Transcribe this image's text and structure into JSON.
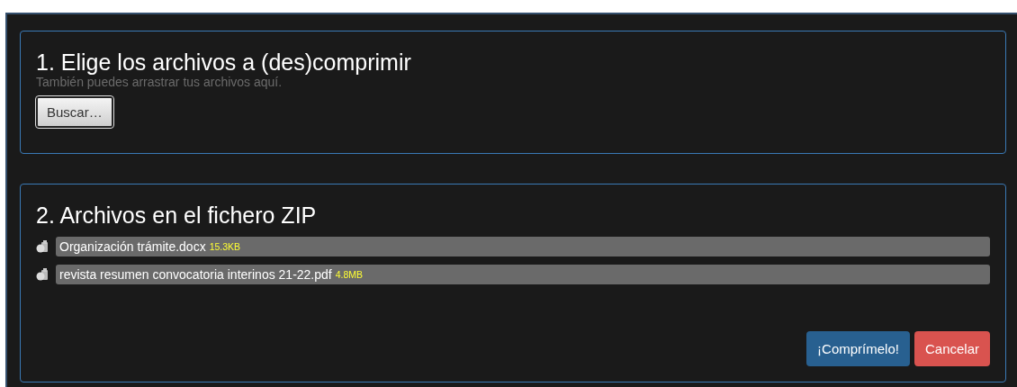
{
  "step1": {
    "title": "1. Elige los archivos a (des)comprimir",
    "hint": "También puedes arrastrar tus archivos aquí.",
    "browse_button": "Buscar…"
  },
  "step2": {
    "title": "2. Archivos en el fichero ZIP",
    "files": [
      {
        "name": "Organización trámite.docx",
        "size": "15.3KB"
      },
      {
        "name": "revista resumen convocatoria interinos 21-22.pdf",
        "size": "4.8MB"
      }
    ],
    "buttons": [
      {
        "label": "¡Comprímelo!",
        "kind": "primary"
      },
      {
        "label": "Cancelar",
        "kind": "danger"
      }
    ]
  }
}
